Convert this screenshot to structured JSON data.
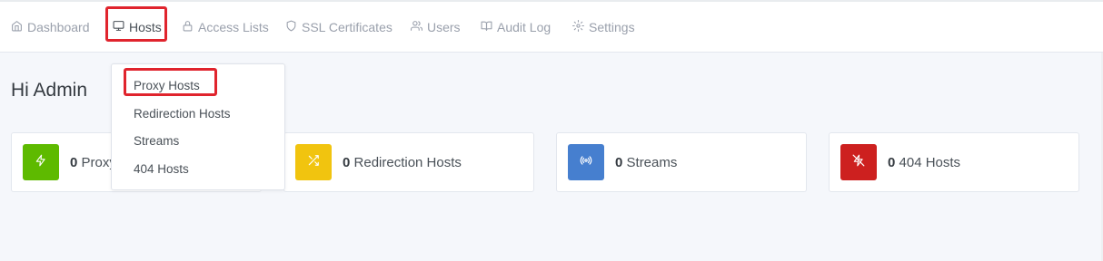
{
  "nav": {
    "items": [
      {
        "label": "Dashboard",
        "icon": "home-icon"
      },
      {
        "label": "Hosts",
        "icon": "monitor-icon"
      },
      {
        "label": "Access Lists",
        "icon": "lock-icon"
      },
      {
        "label": "SSL Certificates",
        "icon": "shield-icon"
      },
      {
        "label": "Users",
        "icon": "users-icon"
      },
      {
        "label": "Audit Log",
        "icon": "book-icon"
      },
      {
        "label": "Settings",
        "icon": "gear-icon"
      }
    ],
    "active": "Hosts"
  },
  "greeting": "Hi Admin",
  "hosts_menu": {
    "items": [
      "Proxy Hosts",
      "Redirection Hosts",
      "Streams",
      "404 Hosts"
    ]
  },
  "cards": [
    {
      "count": "0",
      "label": "Proxy Hosts",
      "visible_label": "Proxy",
      "color": "#5eba00",
      "icon": "zap-icon"
    },
    {
      "count": "0",
      "label": "Redirection Hosts",
      "color": "#f1c40f",
      "icon": "shuffle-icon"
    },
    {
      "count": "0",
      "label": "Streams",
      "color": "#467fcf",
      "icon": "radio-icon"
    },
    {
      "count": "0",
      "label": "404 Hosts",
      "color": "#cd201f",
      "icon": "zap-off-icon"
    }
  ],
  "highlight_color": "#e0242d"
}
